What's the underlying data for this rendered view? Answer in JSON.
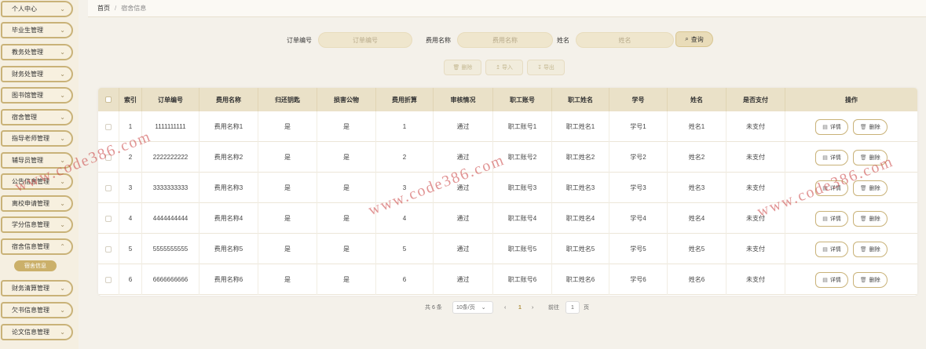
{
  "sidebar": {
    "items": [
      {
        "label": "个人中心"
      },
      {
        "label": "毕业生管理"
      },
      {
        "label": "教务处管理"
      },
      {
        "label": "财务处管理"
      },
      {
        "label": "图书馆管理"
      },
      {
        "label": "宿舍管理"
      },
      {
        "label": "指导老师管理"
      },
      {
        "label": "辅导员管理"
      },
      {
        "label": "公告信息管理"
      },
      {
        "label": "离校申请管理"
      },
      {
        "label": "学分信息管理"
      },
      {
        "label": "宿舍信息管理"
      },
      {
        "label": "财务清算管理"
      },
      {
        "label": "欠书信息管理"
      },
      {
        "label": "论文信息管理"
      }
    ],
    "active_submenu": "宿舍信息"
  },
  "breadcrumb": {
    "home": "首页",
    "current": "宿舍信息"
  },
  "search": {
    "order_label": "订单编号",
    "order_placeholder": "订单编号",
    "fee_label": "费用名称",
    "fee_placeholder": "费用名称",
    "name_label": "姓名",
    "name_placeholder": "姓名",
    "button": "查询"
  },
  "actions": {
    "delete": "删除",
    "import": "导入",
    "export": "导出"
  },
  "table": {
    "headers": [
      "索引",
      "订单编号",
      "费用名称",
      "归还钥匙",
      "损害公物",
      "费用折算",
      "审核情况",
      "职工账号",
      "职工姓名",
      "学号",
      "姓名",
      "是否支付",
      "操作"
    ],
    "rows": [
      {
        "index": "1",
        "order": "1111111111",
        "fee": "费用名称1",
        "key": "是",
        "damage": "是",
        "amount": "1",
        "audit": "通过",
        "staff_acc": "职工账号1",
        "staff_name": "职工姓名1",
        "sid": "学号1",
        "name": "姓名1",
        "paid": "未支付"
      },
      {
        "index": "2",
        "order": "2222222222",
        "fee": "费用名称2",
        "key": "是",
        "damage": "是",
        "amount": "2",
        "audit": "通过",
        "staff_acc": "职工账号2",
        "staff_name": "职工姓名2",
        "sid": "学号2",
        "name": "姓名2",
        "paid": "未支付"
      },
      {
        "index": "3",
        "order": "3333333333",
        "fee": "费用名称3",
        "key": "是",
        "damage": "是",
        "amount": "3",
        "audit": "通过",
        "staff_acc": "职工账号3",
        "staff_name": "职工姓名3",
        "sid": "学号3",
        "name": "姓名3",
        "paid": "未支付"
      },
      {
        "index": "4",
        "order": "4444444444",
        "fee": "费用名称4",
        "key": "是",
        "damage": "是",
        "amount": "4",
        "audit": "通过",
        "staff_acc": "职工账号4",
        "staff_name": "职工姓名4",
        "sid": "学号4",
        "name": "姓名4",
        "paid": "未支付"
      },
      {
        "index": "5",
        "order": "5555555555",
        "fee": "费用名称5",
        "key": "是",
        "damage": "是",
        "amount": "5",
        "audit": "通过",
        "staff_acc": "职工账号5",
        "staff_name": "职工姓名5",
        "sid": "学号5",
        "name": "姓名5",
        "paid": "未支付"
      },
      {
        "index": "6",
        "order": "6666666666",
        "fee": "费用名称6",
        "key": "是",
        "damage": "是",
        "amount": "6",
        "audit": "通过",
        "staff_acc": "职工账号6",
        "staff_name": "职工姓名6",
        "sid": "学号6",
        "name": "姓名6",
        "paid": "未支付"
      }
    ],
    "detail_label": "详情",
    "delete_label": "删除"
  },
  "pagination": {
    "total": "共 6 条",
    "page_size": "10条/页",
    "prev": "‹",
    "current": "1",
    "next": "›",
    "goto_label": "前往",
    "goto_value": "1",
    "page_unit": "页"
  },
  "watermark": "www.code386.com"
}
